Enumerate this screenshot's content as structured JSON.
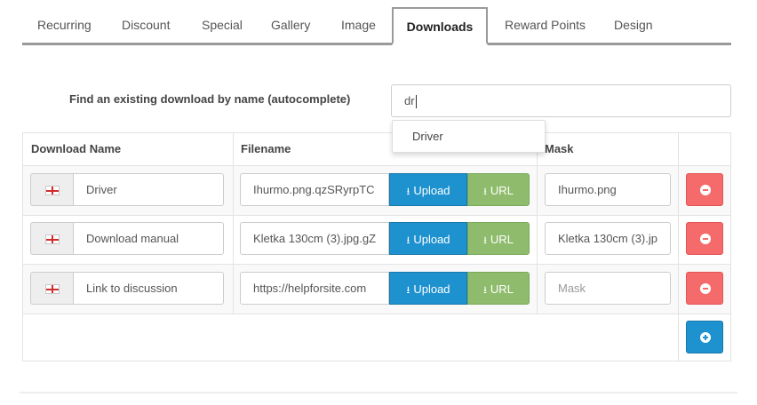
{
  "tabs": [
    {
      "label": "Recurring"
    },
    {
      "label": "Discount"
    },
    {
      "label": "Special"
    },
    {
      "label": "Gallery"
    },
    {
      "label": "Image"
    },
    {
      "label": "Downloads",
      "active": true
    },
    {
      "label": "Reward Points"
    },
    {
      "label": "Design"
    }
  ],
  "autocomplete": {
    "label": "Find an existing download by name (autocomplete)",
    "value": "dr",
    "suggestions": [
      "Driver"
    ]
  },
  "table": {
    "headers": {
      "name": "Download Name",
      "filename": "Filename",
      "mask": "Mask"
    },
    "rows": [
      {
        "name": "Driver",
        "filename": "Ihurmo.png.qzSRyrpTC",
        "mask": "Ihurmo.png"
      },
      {
        "name": "Download manual",
        "filename": "Kletka 130cm (3).jpg.gZ",
        "mask": "Kletka 130cm (3).jp"
      },
      {
        "name": "Link to discussion",
        "filename": "https://helpforsite.com",
        "mask": "",
        "mask_placeholder": "Mask"
      }
    ],
    "upload_label": "Upload",
    "url_label": "URL"
  },
  "icons": {
    "language_flag": "uk-flag-icon",
    "upload": "upload-icon",
    "remove": "minus-circle-icon",
    "add": "plus-circle-icon"
  },
  "colors": {
    "primary": "#1e91cf",
    "success": "#8fbb6c",
    "danger": "#f56b6b"
  }
}
